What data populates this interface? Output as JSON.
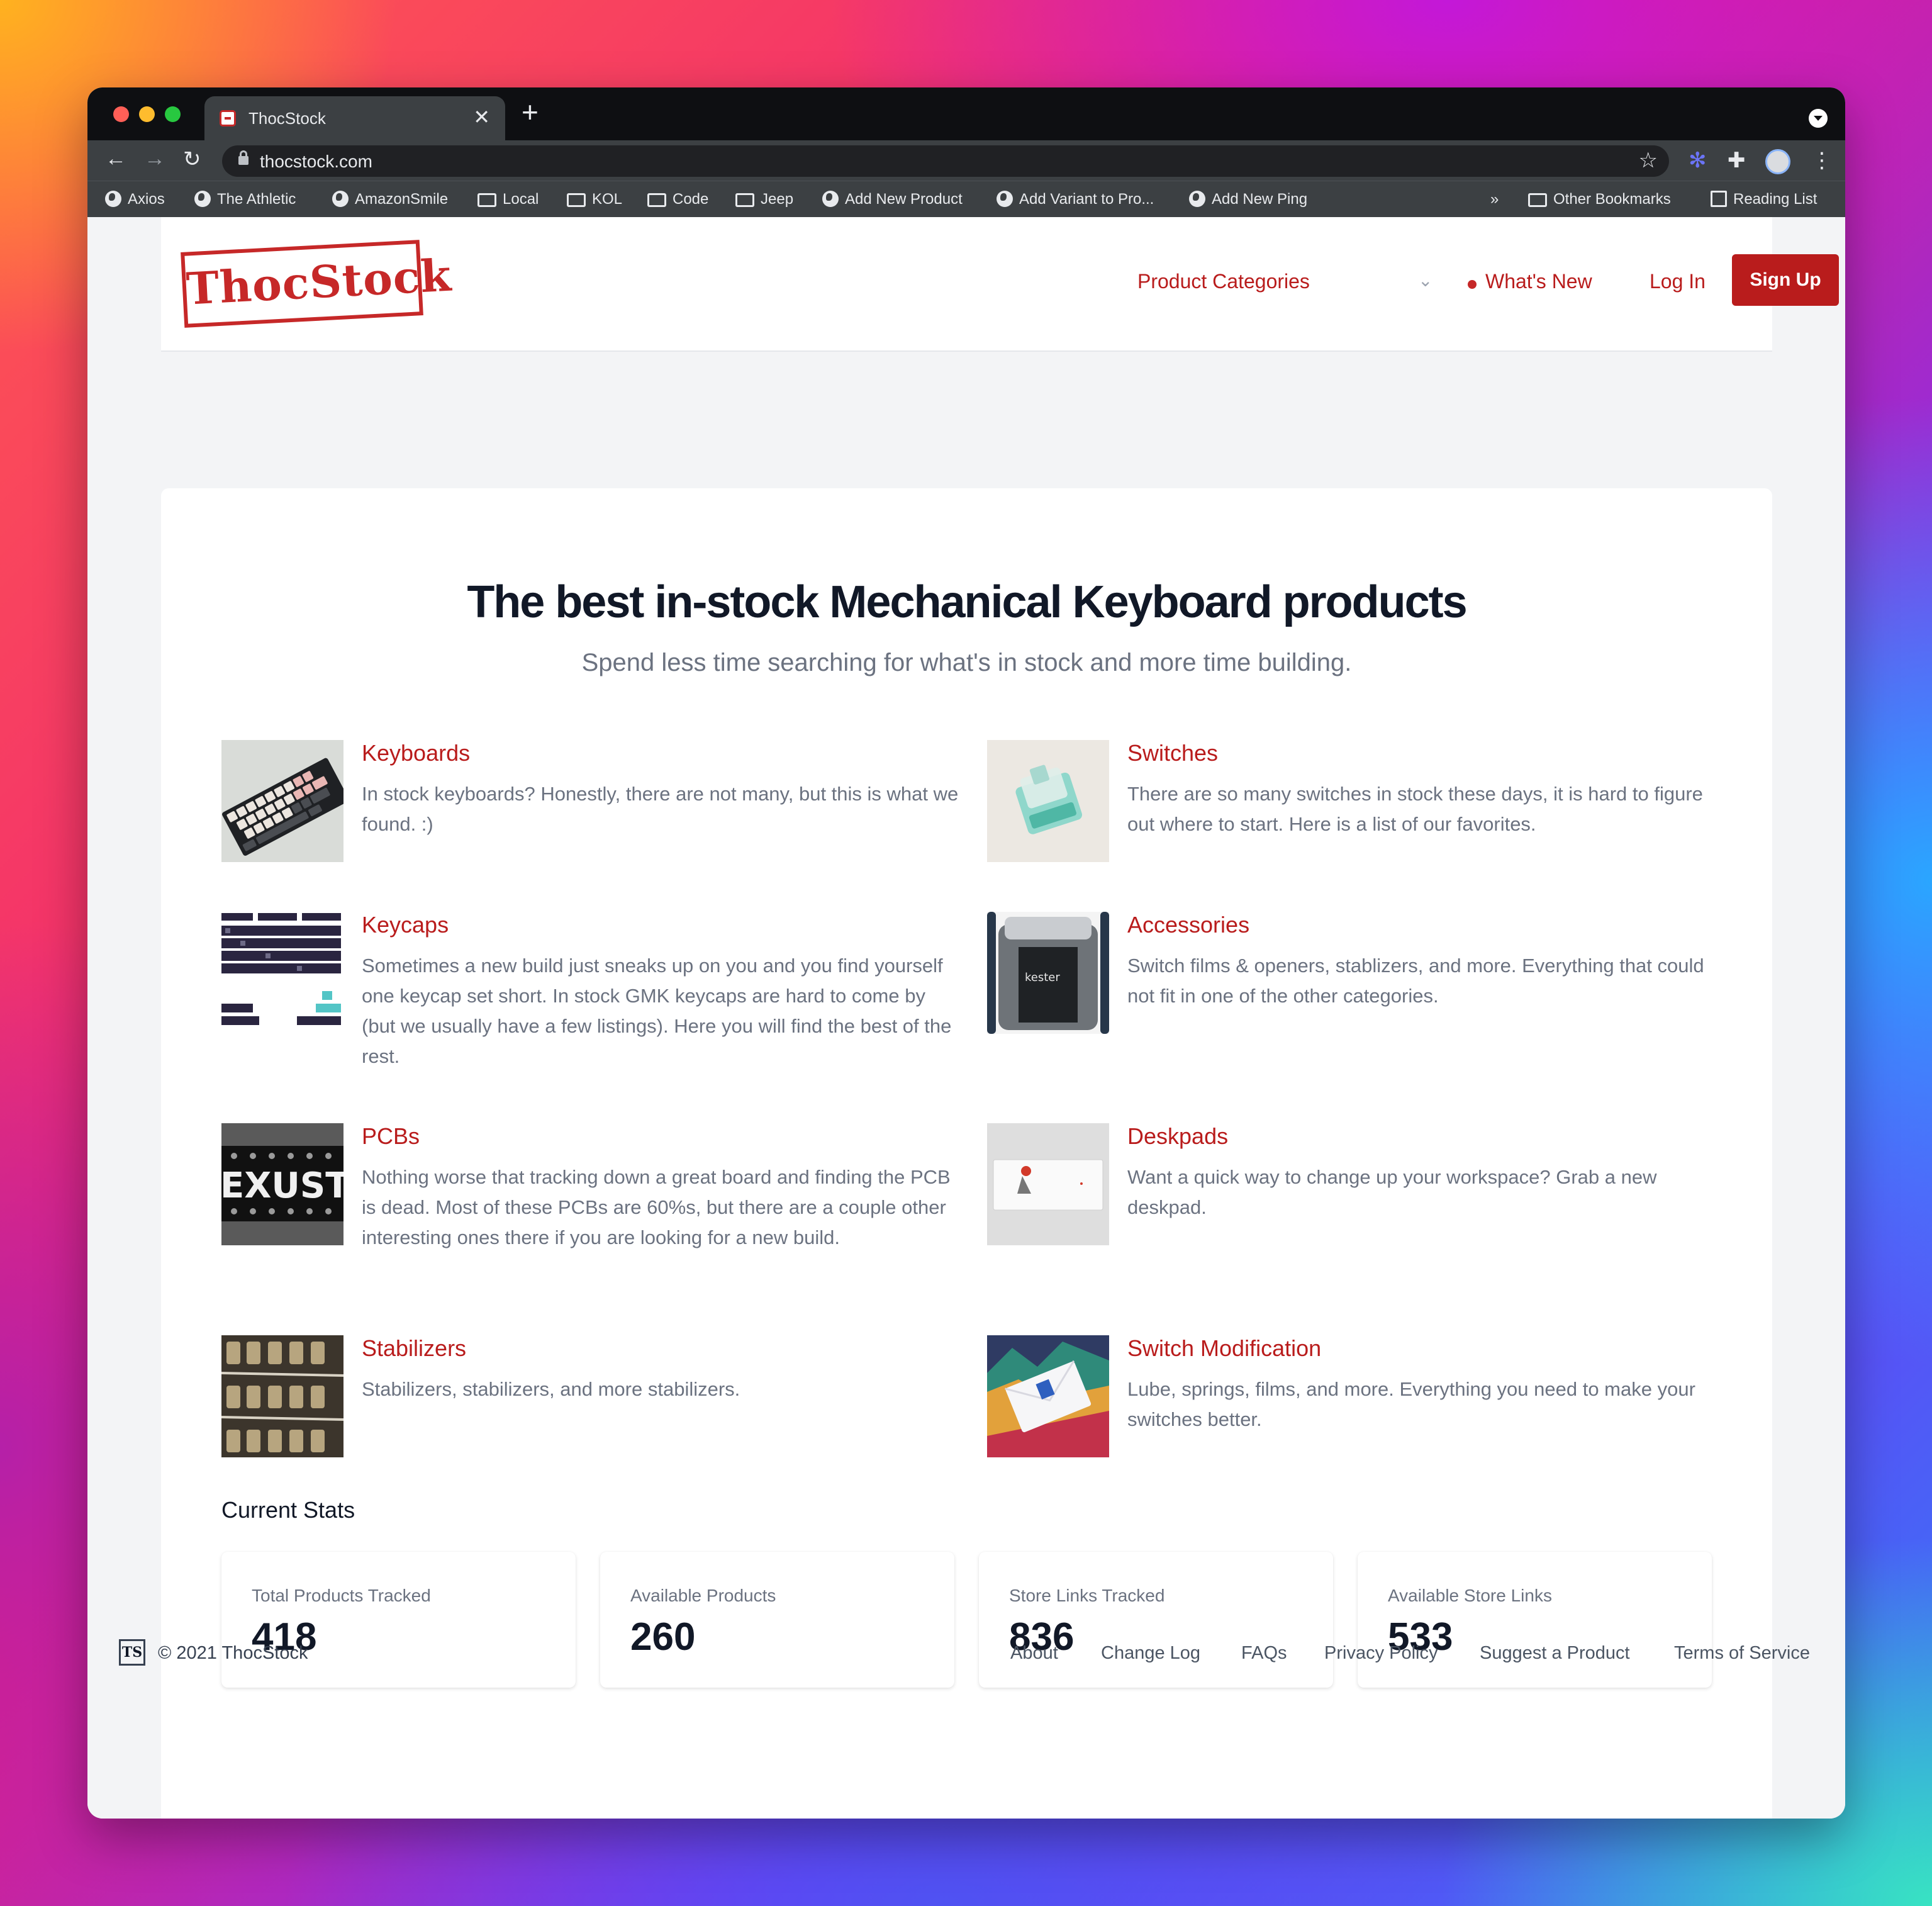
{
  "browser": {
    "tab_title": "ThocStock",
    "tab_close": "✕",
    "new_tab": "+",
    "url": "thocstock.com",
    "back": "←",
    "forward": "→",
    "reload": "↻",
    "star": "☆",
    "icons": [
      "lock-icon",
      "star-icon",
      "gear-extension-icon",
      "puzzle-extensions-icon",
      "profile-avatar",
      "more-menu-icon"
    ],
    "bookmarks": [
      {
        "label": "Axios",
        "icon": "globe-icon"
      },
      {
        "label": "The Athletic",
        "icon": "globe-icon"
      },
      {
        "label": "AmazonSmile",
        "icon": "globe-icon"
      },
      {
        "label": "Local",
        "icon": "folder-icon"
      },
      {
        "label": "KOL",
        "icon": "folder-icon"
      },
      {
        "label": "Code",
        "icon": "folder-icon"
      },
      {
        "label": "Jeep",
        "icon": "folder-icon"
      },
      {
        "label": "Add New Product",
        "icon": "globe-icon"
      },
      {
        "label": "Add Variant to Pro...",
        "icon": "globe-icon"
      },
      {
        "label": "Add New Ping",
        "icon": "globe-icon"
      }
    ],
    "bookmarks_overflow": "»",
    "other_bookmarks": "Other Bookmarks",
    "reading_list": "Reading List"
  },
  "header": {
    "logo_text": "ThocStock",
    "nav": {
      "product_categories": "Product Categories",
      "chevron": "⌄",
      "whats_new": "What's New",
      "log_in": "Log In",
      "sign_up": "Sign Up"
    }
  },
  "hero": {
    "title": "The best in-stock Mechanical Keyboard products",
    "subtitle": "Spend less time searching for what's in stock and more time building."
  },
  "categories": [
    {
      "title": "Keyboards",
      "description": "In stock keyboards? Honestly, there are not many, but this is what we found. :)"
    },
    {
      "title": "Switches",
      "description": "There are so many switches in stock these days, it is hard to figure out where to start. Here is a list of our favorites."
    },
    {
      "title": "Keycaps",
      "description": "Sometimes a new build just sneaks up on you and you find yourself one keycap set short. In stock GMK keycaps are hard to come by (but we usually have a few listings). Here you will find the best of the rest."
    },
    {
      "title": "Accessories",
      "description": "Switch films & openers, stablizers, and more. Everything that could not fit in one of the other categories."
    },
    {
      "title": "PCBs",
      "description": "Nothing worse that tracking down a great board and finding the PCB is dead. Most of these PCBs are 60%s, but there are a couple other interesting ones there if you are looking for a new build."
    },
    {
      "title": "Deskpads",
      "description": "Want a quick way to change up your workspace? Grab a new deskpad."
    },
    {
      "title": "Stabilizers",
      "description": "Stabilizers, stabilizers, and more stabilizers."
    },
    {
      "title": "Switch Modification",
      "description": "Lube, springs, films, and more. Everything you need to make your switches better."
    }
  ],
  "thumb_text": {
    "pcb": "EXUST",
    "solder_brand": "kester"
  },
  "stats": {
    "title": "Current Stats",
    "items": [
      {
        "label": "Total Products Tracked",
        "value": "418"
      },
      {
        "label": "Available Products",
        "value": "260"
      },
      {
        "label": "Store Links Tracked",
        "value": "836"
      },
      {
        "label": "Available Store Links",
        "value": "533"
      }
    ]
  },
  "footer": {
    "logo_text": "TS",
    "copyright": "© 2021 ThocStock",
    "links": [
      "About",
      "Change Log",
      "FAQs",
      "Privacy Policy",
      "Suggest a Product",
      "Terms of Service"
    ]
  },
  "colors": {
    "brand_red": "#b91c1c",
    "heading": "#111827",
    "muted": "#6b7280"
  }
}
